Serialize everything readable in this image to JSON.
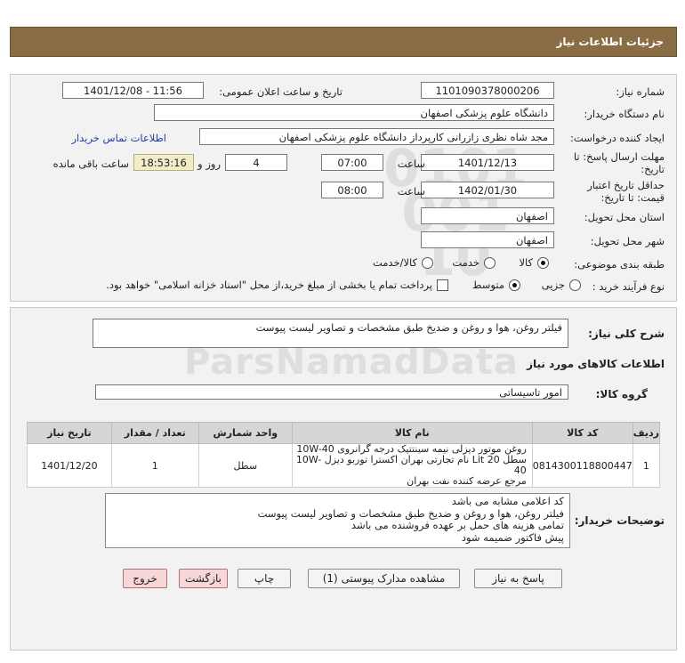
{
  "header": {
    "title": "جزئیات اطلاعات نیاز"
  },
  "form": {
    "need_number_label": "شماره نیاز:",
    "need_number": "1101090378000206",
    "announce_label": "تاریخ و ساعت اعلان عمومی:",
    "announce_value": "1401/12/08 - 11:56",
    "buyer_org_label": "نام دستگاه خریدار:",
    "buyer_org": "دانشگاه علوم پزشکی اصفهان",
    "creator_label": "ایجاد کننده درخواست:",
    "creator": "مجد شاه نظری زازرانی کارپرداز دانشگاه علوم پزشکی اصفهان",
    "contact_link": "اطلاعات تماس خریدار",
    "deadline_label_1": "مهلت ارسال پاسخ: تا",
    "deadline_label_2": "تاریخ:",
    "deadline_date": "1401/12/13",
    "time_label": "ساعت",
    "deadline_time": "07:00",
    "days_value": "4",
    "days_label": "روز و",
    "countdown": "18:53:16",
    "remaining_label": "ساعت باقی مانده",
    "validity_label_1": "حداقل تاریخ اعتبار",
    "validity_label_2": "قیمت: تا تاریخ:",
    "validity_date": "1402/01/30",
    "validity_time": "08:00",
    "province_label": "استان محل تحویل:",
    "province": "اصفهان",
    "city_label": "شهر محل تحویل:",
    "city": "اصفهان",
    "category_label": "طبقه بندی موضوعی:",
    "category_options": [
      "کالا",
      "خدمت",
      "کالا/خدمت"
    ],
    "process_label": "نوع فرآیند خرید :",
    "process_options": [
      "جزیی",
      "متوسط"
    ],
    "treasury_note": "پرداخت تمام یا بخشی از مبلغ خرید،از محل \"اسناد خزانه اسلامی\" خواهد بود."
  },
  "details": {
    "summary_label": "شرح کلی نیاز:",
    "summary": "فیلتر روغن، هوا و روغن و ضدیخ طبق مشخصات و تصاویر لیست پیوست",
    "goods_info_title": "اطلاعات کالاهای مورد نیاز",
    "group_label": "گروه کالا:",
    "group": "امور تاسیساتی",
    "table": {
      "headers": [
        "ردیف",
        "کد کالا",
        "نام کالا",
        "واحد شمارش",
        "تعداد / مقدار",
        "تاریخ نیاز"
      ],
      "rows": [
        {
          "row": "1",
          "code": "0814300118800447",
          "name_line1": "روغن موتور دیزلی نیمه سینتتیک درجه گرانروی 10W-40",
          "name_line2": "سطل 20 Lit نام تجارتی بهران اکسترا توربو دیزل 10W-40",
          "name_line3": "مرجع عرضه کننده نفت بهران",
          "unit": "سطل",
          "qty": "1",
          "date": "1401/12/20"
        }
      ]
    },
    "buyer_notes_label": "توضیحات خریدار:",
    "buyer_notes": [
      "کد اعلامی مشابه می باشد",
      "فیلتر روغن، هوا و روغن و ضدیخ طبق مشخصات و تصاویر لیست پیوست",
      "تمامی هزینه های حمل بر عهده فروشنده می باشد",
      "پیش فاکتور ضمیمه شود"
    ]
  },
  "buttons": {
    "reply": "پاسخ به نیاز",
    "attachments": "مشاهده مدارک پیوستی (1)",
    "print": "چاپ",
    "back": "بازگشت",
    "exit": "خروج"
  },
  "watermark": {
    "main": "ParsNamadData",
    "numbers": "0101 001 10"
  }
}
